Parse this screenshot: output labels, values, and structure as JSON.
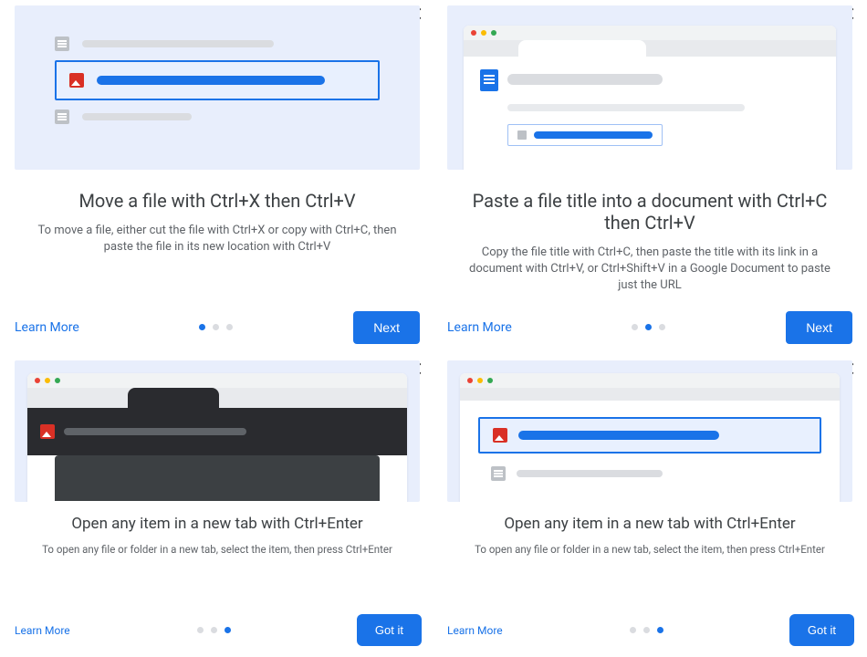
{
  "cards": [
    {
      "title": "Move a file with Ctrl+X then Ctrl+V",
      "desc": "To move a file, either cut the file with Ctrl+X or copy with Ctrl+C, then paste the file in its new location with Ctrl+V",
      "learn": "Learn More",
      "button": "Next",
      "dots_total": 3,
      "dots_active": 0
    },
    {
      "title": "Paste a file title into a document with Ctrl+C then Ctrl+V",
      "desc": "Copy the file title with Ctrl+C, then paste the title with its link in a document with Ctrl+V, or Ctrl+Shift+V in a Google Document to paste just the URL",
      "learn": "Learn More",
      "button": "Next",
      "dots_total": 3,
      "dots_active": 1
    },
    {
      "title": "Open any item in a new tab with Ctrl+Enter",
      "desc": "To open any file or folder in a new tab, select the item, then press Ctrl+Enter",
      "learn": "Learn More",
      "button": "Got it",
      "dots_total": 3,
      "dots_active": 2
    },
    {
      "title": "Open any item in a new tab with Ctrl+Enter",
      "desc": "To open any file or folder in a new tab, select the item, then press Ctrl+Enter",
      "learn": "Learn More",
      "button": "Got it",
      "dots_total": 3,
      "dots_active": 2
    }
  ]
}
